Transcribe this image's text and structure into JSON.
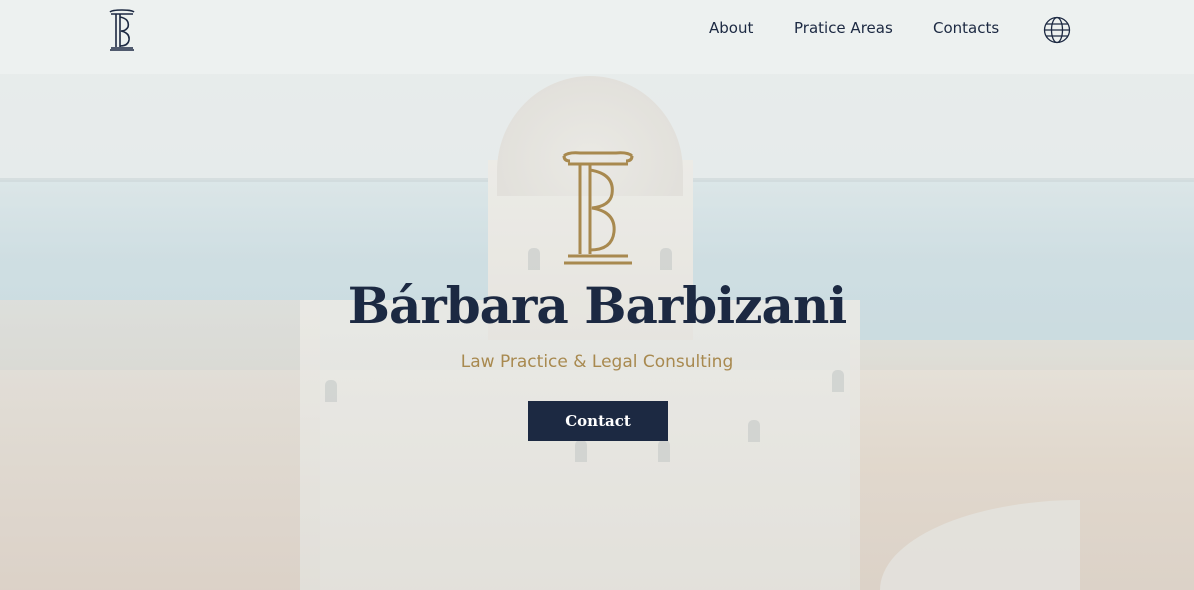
{
  "brand": {
    "logo_icon": "column-b-logo-icon",
    "accent": "#a8894f",
    "navy": "#1c2942"
  },
  "nav": {
    "items": [
      {
        "label": "About"
      },
      {
        "label": "Pratice Areas"
      },
      {
        "label": "Contacts"
      }
    ],
    "language_icon": "globe-icon"
  },
  "hero": {
    "emblem_icon": "column-b-emblem-icon",
    "title": "Bárbara Barbizani",
    "subtitle": "Law Practice & Legal Consulting",
    "cta_label": "Contact"
  }
}
